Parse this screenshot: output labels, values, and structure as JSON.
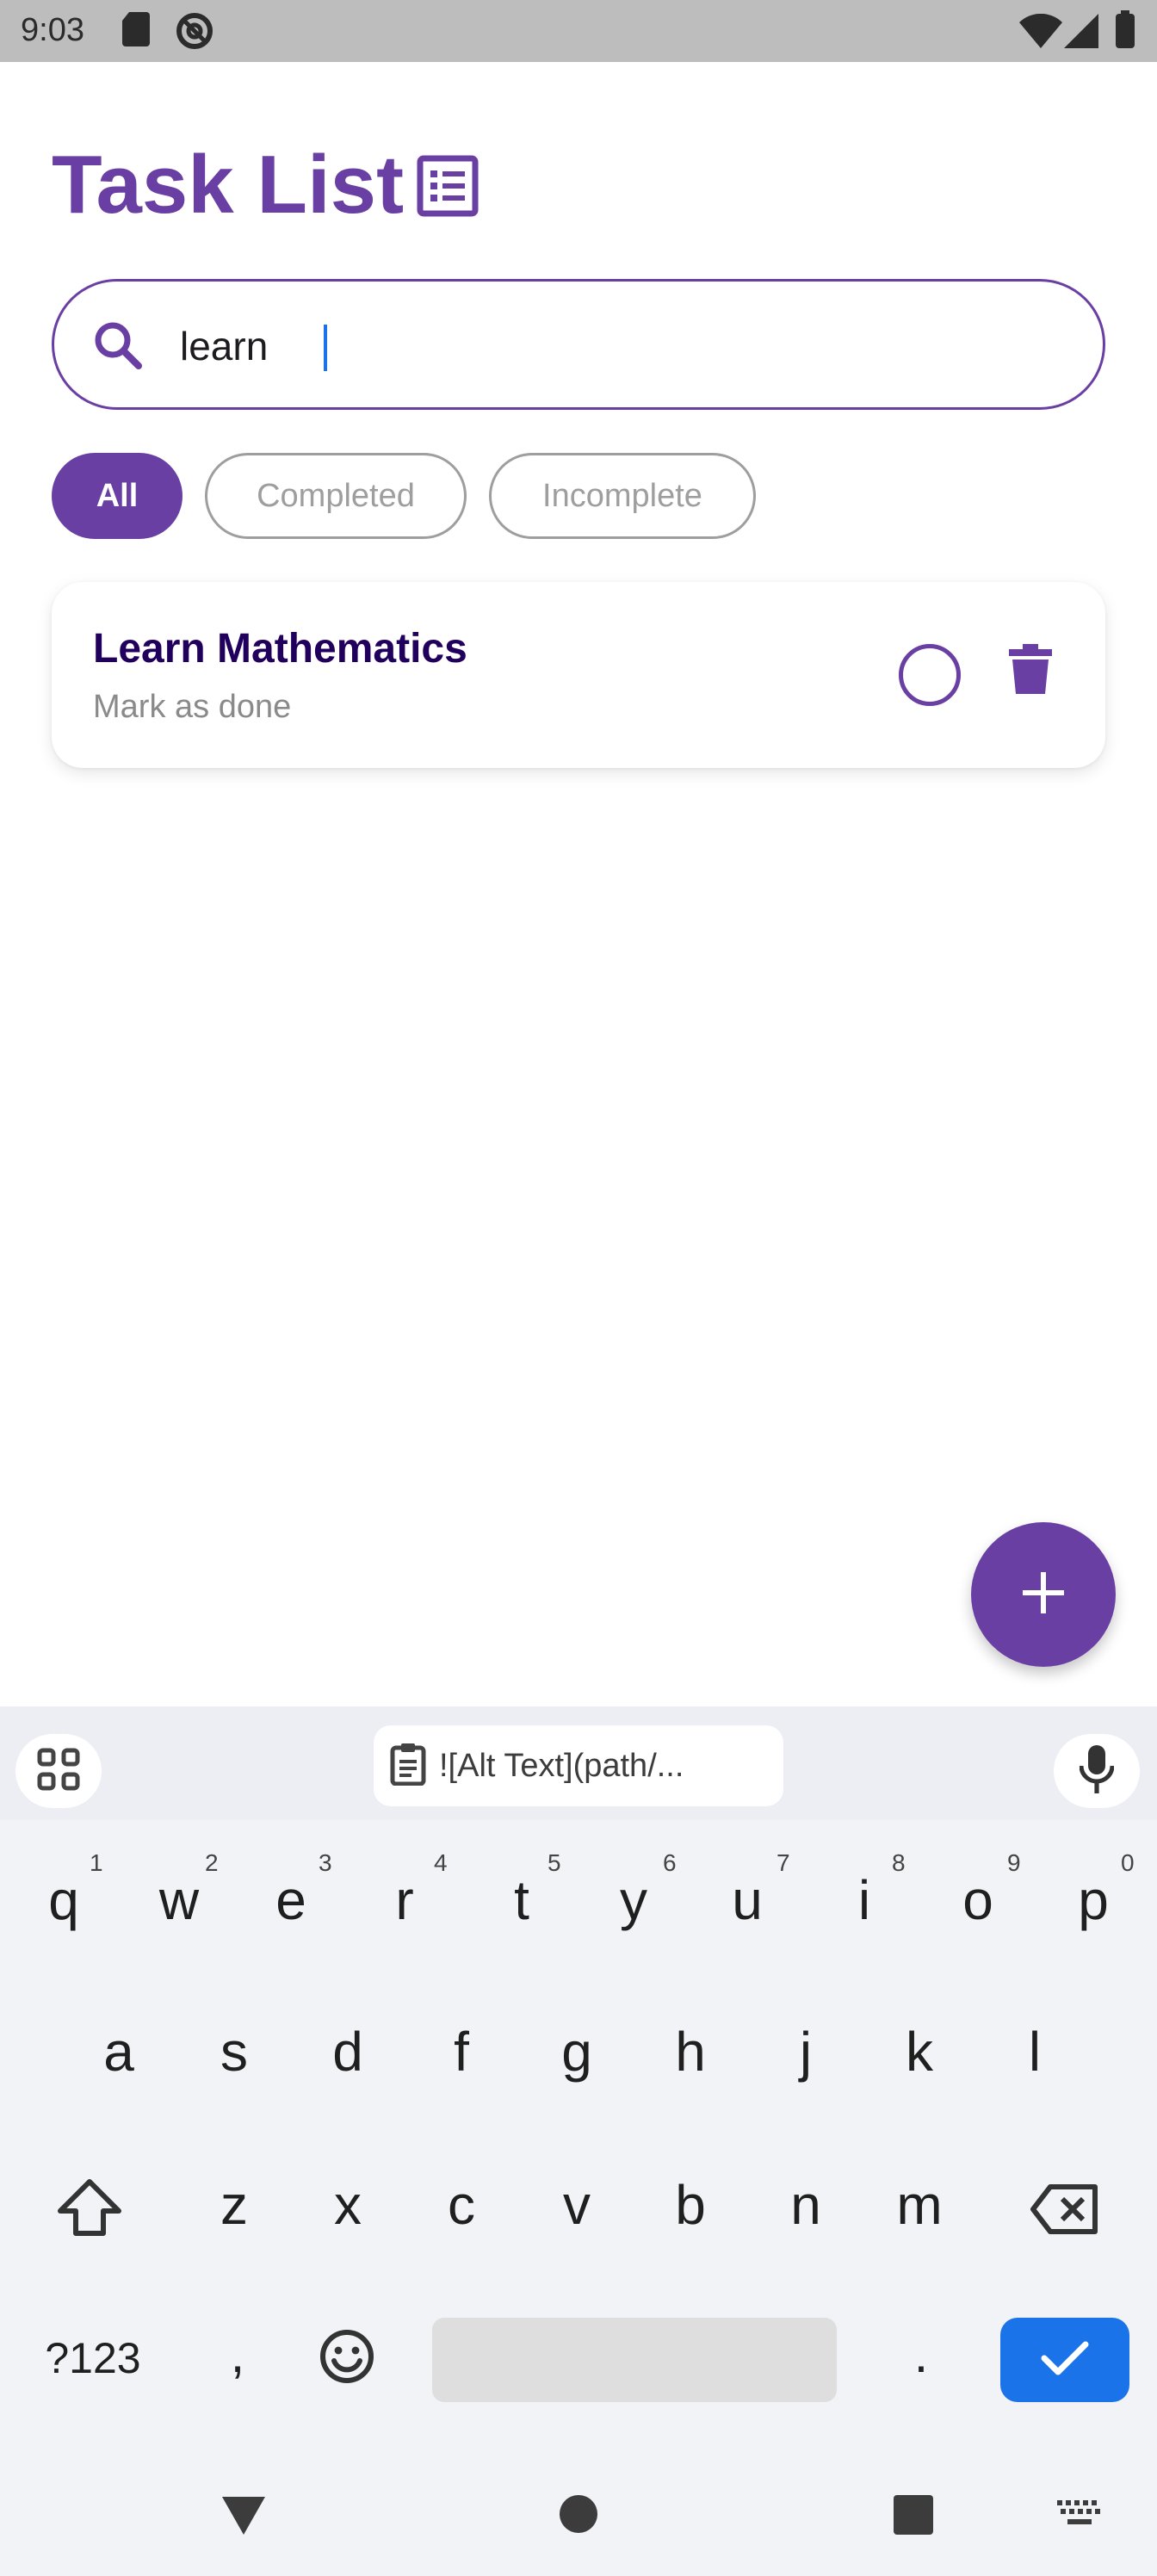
{
  "status_bar": {
    "time": "9:03",
    "left_icons": [
      "sd-card-icon",
      "no-disturb-icon"
    ],
    "right_icons": [
      "wifi-icon",
      "signal-icon",
      "battery-icon"
    ]
  },
  "header": {
    "title": "Task List",
    "icon": "list-alt-icon"
  },
  "search": {
    "value": "learn",
    "icon": "search-icon"
  },
  "filters": {
    "selected": "All",
    "chips": [
      "All",
      "Completed",
      "Incomplete"
    ]
  },
  "tasks": [
    {
      "title": "Learn Mathematics",
      "subtitle": "Mark as done",
      "completed": false
    }
  ],
  "fab": {
    "icon": "plus-icon"
  },
  "keyboard": {
    "clipboard_text": "![Alt Text](path/...",
    "row1": [
      "q",
      "w",
      "e",
      "r",
      "t",
      "y",
      "u",
      "i",
      "o",
      "p"
    ],
    "row1_hints": [
      "1",
      "2",
      "3",
      "4",
      "5",
      "6",
      "7",
      "8",
      "9",
      "0"
    ],
    "row2": [
      "a",
      "s",
      "d",
      "f",
      "g",
      "h",
      "j",
      "k",
      "l"
    ],
    "row3": [
      "z",
      "x",
      "c",
      "v",
      "b",
      "n",
      "m"
    ],
    "symbols_label": "?123",
    "comma": ",",
    "period": "."
  },
  "colors": {
    "accent": "#6a3fa3",
    "enter_key": "#1a73e8",
    "status_bar": "#bdbdbd"
  }
}
